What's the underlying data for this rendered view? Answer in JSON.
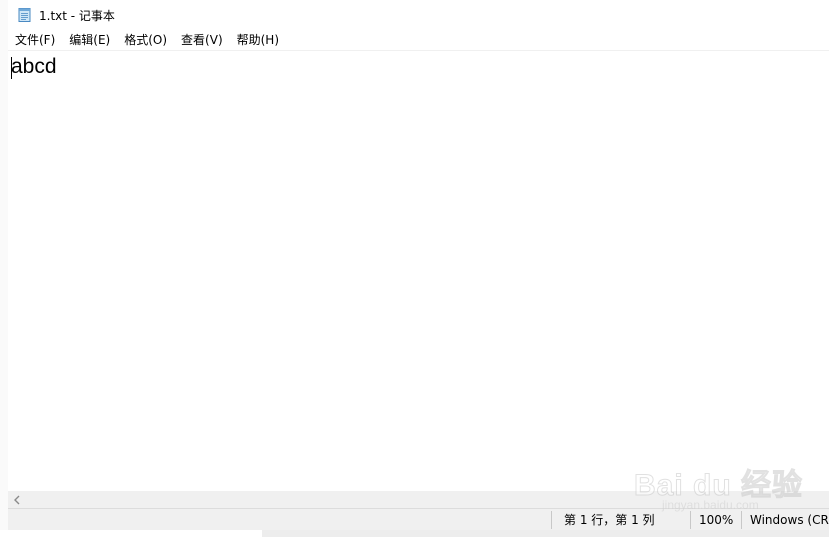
{
  "window": {
    "title": "1.txt - 记事本"
  },
  "menubar": {
    "items": [
      {
        "label": "文件(F)"
      },
      {
        "label": "编辑(E)"
      },
      {
        "label": "格式(O)"
      },
      {
        "label": "查看(V)"
      },
      {
        "label": "帮助(H)"
      }
    ]
  },
  "editor": {
    "content": "abcd"
  },
  "statusbar": {
    "position": "第 1 行，第 1 列",
    "zoom": "100%",
    "line_ending": "Windows (CRLF)"
  },
  "watermark": {
    "text": "Bai du 经验",
    "subtext": "jingyan.baidu.com"
  },
  "icons": {
    "app": "notepad-icon",
    "scroll_left": "chevron-left-icon"
  }
}
